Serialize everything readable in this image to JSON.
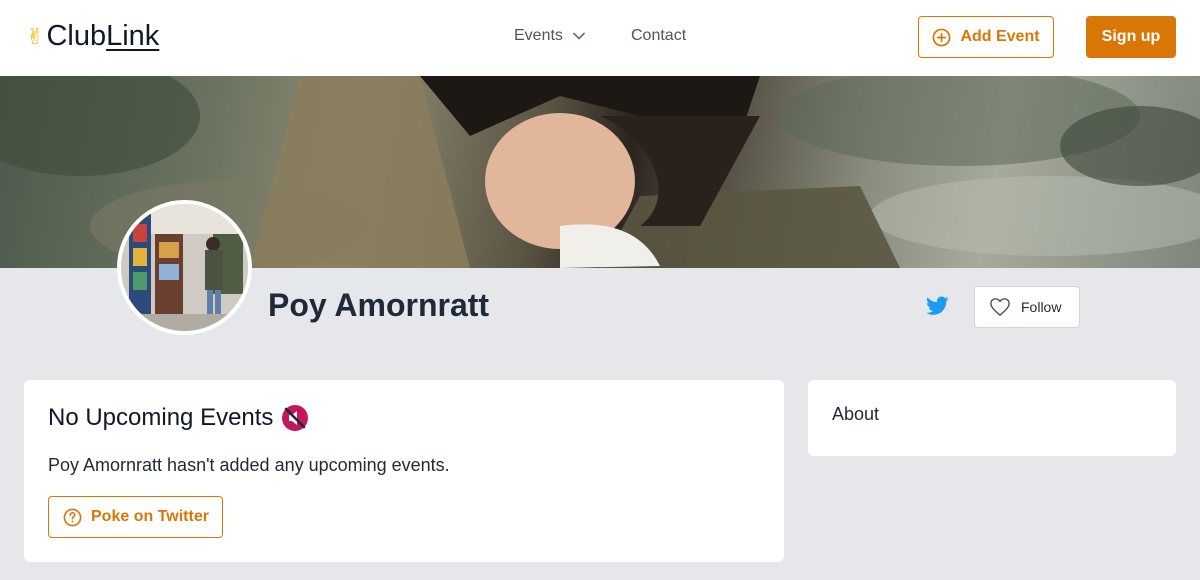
{
  "nav": {
    "logo_text_a": "Club",
    "logo_text_b": "Link",
    "logo_icon": "victory-hand-icon",
    "events_label": "Events",
    "contact_label": "Contact",
    "add_event_label": "Add Event",
    "signup_label": "Sign up"
  },
  "profile": {
    "name": "Poy Amornratt",
    "follow_label": "Follow",
    "social_icon": "twitter-icon"
  },
  "events_card": {
    "title": "No Upcoming Events",
    "title_icon": "muted-speaker-icon",
    "message": "Poy Amornratt hasn't added any upcoming events.",
    "poke_label": "Poke on Twitter"
  },
  "about_card": {
    "title": "About"
  },
  "colors": {
    "accent": "#d97706",
    "twitter": "#1d9bf0",
    "background": "#e5e7eb"
  }
}
